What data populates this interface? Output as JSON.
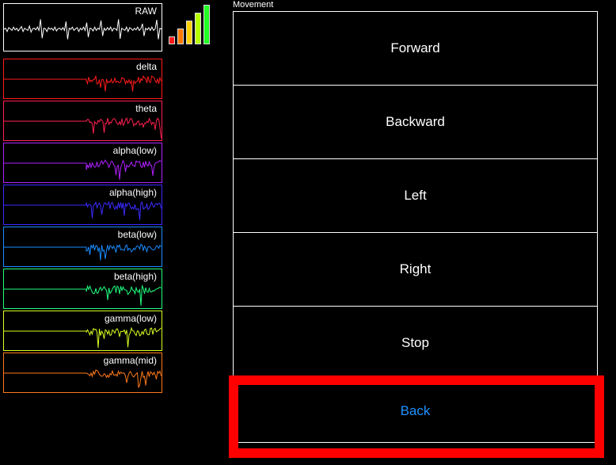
{
  "raw": {
    "label": "RAW",
    "color": "#ffffff",
    "trace": [
      0,
      0.1,
      -0.2,
      0.15,
      0.05,
      -0.1,
      0.2,
      -0.05,
      0.1,
      -0.15,
      0.05,
      0.25,
      -0.2,
      0.1,
      0,
      -0.1,
      0.3,
      -0.25,
      0.05,
      0.1,
      -0.05,
      0.2,
      -0.1,
      0.9,
      -0.8,
      0.1,
      0.05,
      -0.2,
      0.15,
      0,
      0.1,
      -0.1,
      0.2,
      -0.15,
      0.05,
      0.1,
      -0.05,
      0.15,
      -0.1,
      0.7,
      -0.9,
      0.1,
      0,
      0.2,
      -0.1,
      0.05,
      0.15,
      -0.2,
      0.1,
      -0.05,
      0.2,
      -0.1,
      0.6,
      -0.7,
      0.1,
      0.05,
      -0.15,
      0.2,
      -0.1,
      0.1,
      0,
      0.8,
      -0.6,
      0.1,
      -0.1,
      0.15,
      -0.05,
      0.2,
      -0.15,
      0.1,
      0.05,
      -0.1,
      0.9,
      -0.85,
      0.1,
      0,
      -0.1,
      0.2,
      -0.2,
      0.15,
      0.05,
      -0.1,
      0.1,
      -0.05,
      0.2,
      -0.1,
      0.05,
      0.5,
      -0.6,
      0.1,
      -0.05,
      0.15,
      -0.1,
      0.2,
      -0.1,
      0.05,
      0.85,
      -0.9,
      0.1,
      0
    ]
  },
  "signal_meter": {
    "levels": [
      0.2,
      0.4,
      0.6,
      0.8,
      1.0
    ],
    "colors": [
      "#ff1a1a",
      "#ff7a00",
      "#ffd000",
      "#b8ff00",
      "#22ff22"
    ]
  },
  "bands": [
    {
      "id": "delta",
      "label": "delta",
      "color": "#ff1a1a"
    },
    {
      "id": "theta",
      "label": "theta",
      "color": "#ff2050"
    },
    {
      "id": "alpha-low",
      "label": "alpha(low)",
      "color": "#b020ff"
    },
    {
      "id": "alpha-high",
      "label": "alpha(high)",
      "color": "#3a2aff"
    },
    {
      "id": "beta-low",
      "label": "beta(low)",
      "color": "#1a8cff"
    },
    {
      "id": "beta-high",
      "label": "beta(high)",
      "color": "#20ff80"
    },
    {
      "id": "gamma-low",
      "label": "gamma(low)",
      "color": "#d8ff20"
    },
    {
      "id": "gamma-mid",
      "label": "gamma(mid)",
      "color": "#ff7a1a"
    }
  ],
  "movement": {
    "title": "Movement",
    "buttons": [
      {
        "id": "forward",
        "label": "Forward",
        "color": "#ffffff"
      },
      {
        "id": "backward",
        "label": "Backward",
        "color": "#ffffff"
      },
      {
        "id": "left",
        "label": "Left",
        "color": "#ffffff"
      },
      {
        "id": "right",
        "label": "Right",
        "color": "#ffffff"
      },
      {
        "id": "stop",
        "label": "Stop",
        "color": "#ffffff"
      },
      {
        "id": "back",
        "label": "Back",
        "color": "#1e90ff"
      }
    ],
    "selected": "back",
    "highlight_color": "#ff0000"
  }
}
